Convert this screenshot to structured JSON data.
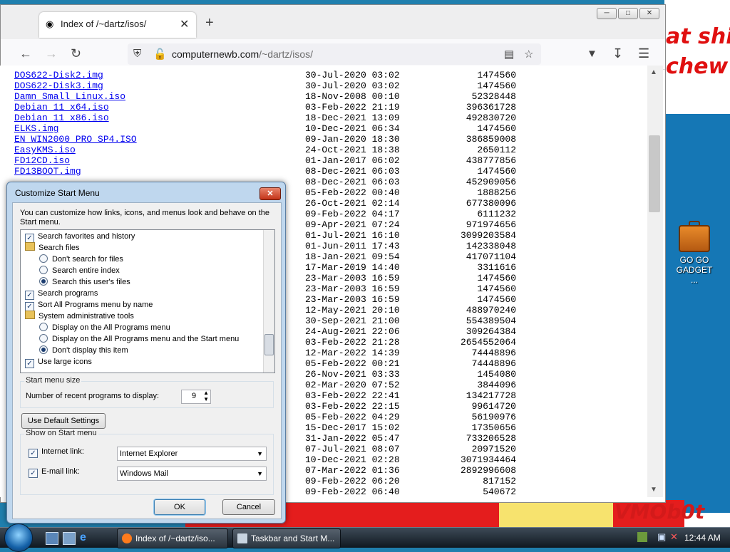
{
  "desktop": {
    "wallpaper_text_1": "at shit",
    "wallpaper_text_2": "chew",
    "brand": "VMOb0t",
    "icon_label_1": "GO GO",
    "icon_label_2": "GADGET ..."
  },
  "browser": {
    "tab_title": "Index of /~dartz/isos/",
    "url_host": "computernewb.com",
    "url_path": "/~dartz/isos/",
    "icons": {
      "back": "back-arrow-icon",
      "forward": "forward-arrow-icon",
      "reload": "reload-icon",
      "shield": "shield-icon",
      "reader": "reader-view-icon",
      "bookmark": "star-icon",
      "pocket": "pocket-icon",
      "downloads": "download-icon",
      "menu": "hamburger-menu-icon"
    }
  },
  "listing": {
    "rows": [
      {
        "name": "DOS622-Disk2.img",
        "date": "30-Jul-2020 03:02",
        "size": "1474560"
      },
      {
        "name": "DOS622-Disk3.img",
        "date": "30-Jul-2020 03:02",
        "size": "1474560"
      },
      {
        "name": "Damn Small Linux.iso",
        "date": "18-Nov-2008 00:10",
        "size": "52328448"
      },
      {
        "name": "Debian 11 x64.iso",
        "date": "03-Feb-2022 21:19",
        "size": "396361728"
      },
      {
        "name": "Debian 11 x86.iso",
        "date": "18-Dec-2021 13:09",
        "size": "492830720"
      },
      {
        "name": "ELKS.img",
        "date": "10-Dec-2021 06:34",
        "size": "1474560"
      },
      {
        "name": "EN WIN2000 PRO SP4.ISO",
        "date": "09-Jan-2020 18:30",
        "size": "386859008"
      },
      {
        "name": "EasyKMS.iso",
        "date": "24-Oct-2021 18:38",
        "size": "2650112"
      },
      {
        "name": "FD12CD.iso",
        "date": "01-Jan-2017 06:02",
        "size": "438777856"
      },
      {
        "name": "FD13BOOT.img",
        "date": "08-Dec-2021 06:03",
        "size": "1474560"
      },
      {
        "name": "",
        "date": "08-Dec-2021 06:03",
        "size": "452909056"
      },
      {
        "name": "",
        "date": "05-Feb-2022 00:40",
        "size": "1888256"
      },
      {
        "name": "",
        "date": "26-Oct-2021 02:14",
        "size": "677380096"
      },
      {
        "name": "",
        "date": "09-Feb-2022 04:17",
        "size": "6111232"
      },
      {
        "name": "",
        "date": "09-Apr-2021 07:24",
        "size": "971974656"
      },
      {
        "name": "",
        "date": "01-Jul-2021 16:10",
        "size": "3099203584"
      },
      {
        "name": "",
        "date": "01-Jun-2011 17:43",
        "size": "142338048"
      },
      {
        "name": "",
        "date": "18-Jan-2021 09:54",
        "size": "417071104"
      },
      {
        "name": "",
        "date": "17-Mar-2019 14:40",
        "size": "3311616"
      },
      {
        "name": "",
        "date": "23-Mar-2003 16:59",
        "size": "1474560"
      },
      {
        "name": "",
        "date": "23-Mar-2003 16:59",
        "size": "1474560"
      },
      {
        "name": "",
        "date": "23-Mar-2003 16:59",
        "size": "1474560"
      },
      {
        "name": "",
        "date": "12-May-2021 20:10",
        "size": "488970240"
      },
      {
        "name": "",
        "date": "30-Sep-2021 21:00",
        "size": "554389504"
      },
      {
        "name": "",
        "date": "24-Aug-2021 22:06",
        "size": "309264384"
      },
      {
        "name": "",
        "date": "03-Feb-2022 21:28",
        "size": "2654552064"
      },
      {
        "name": "",
        "date": "12-Mar-2022 14:39",
        "size": "74448896"
      },
      {
        "name": "",
        "date": "05-Feb-2022 00:21",
        "size": "74448896"
      },
      {
        "name": "",
        "date": "26-Nov-2021 03:33",
        "size": "1454080"
      },
      {
        "name": "",
        "date": "02-Mar-2020 07:52",
        "size": "3844096"
      },
      {
        "name": "",
        "date": "03-Feb-2022 22:41",
        "size": "134217728"
      },
      {
        "name": "",
        "date": "03-Feb-2022 22:15",
        "size": "99614720"
      },
      {
        "name": "",
        "date": "05-Feb-2022 04:29",
        "size": "56190976"
      },
      {
        "name": "",
        "date": "15-Dec-2017 15:02",
        "size": "17350656"
      },
      {
        "name": "",
        "date": "31-Jan-2022 05:47",
        "size": "733206528"
      },
      {
        "name": "",
        "date": "07-Jul-2021 08:07",
        "size": "20971520"
      },
      {
        "name": "",
        "date": "10-Dec-2021 02:28",
        "size": "3071934464"
      },
      {
        "name": "",
        "date": "07-Mar-2022 01:36",
        "size": "2892996608"
      },
      {
        "name": "",
        "date": "09-Feb-2022 06:20",
        "size": "817152"
      },
      {
        "name": "",
        "date": "09-Feb-2022 06:40",
        "size": "540672"
      }
    ]
  },
  "dialog": {
    "title": "Customize Start Menu",
    "description": "You can customize how links, icons, and menus look and behave on the Start menu.",
    "options": [
      {
        "type": "checkbox",
        "checked": true,
        "label": "Search favorites and history",
        "indent": 0
      },
      {
        "type": "folder",
        "label": "Search files",
        "indent": 0
      },
      {
        "type": "radio",
        "checked": false,
        "label": "Don't search for files",
        "indent": 1
      },
      {
        "type": "radio",
        "checked": false,
        "label": "Search entire index",
        "indent": 1
      },
      {
        "type": "radio",
        "checked": true,
        "label": "Search this user's files",
        "indent": 1
      },
      {
        "type": "checkbox",
        "checked": true,
        "label": "Search programs",
        "indent": 0
      },
      {
        "type": "checkbox",
        "checked": true,
        "label": "Sort All Programs menu by name",
        "indent": 0
      },
      {
        "type": "folder",
        "label": "System administrative tools",
        "indent": 0
      },
      {
        "type": "radio",
        "checked": false,
        "label": "Display on the All Programs menu",
        "indent": 1
      },
      {
        "type": "radio",
        "checked": false,
        "label": "Display on the All Programs menu and the Start menu",
        "indent": 1
      },
      {
        "type": "radio",
        "checked": true,
        "label": "Don't display this item",
        "indent": 1
      },
      {
        "type": "checkbox",
        "checked": true,
        "label": "Use large icons",
        "indent": 0
      }
    ],
    "menu_size_group": "Start menu size",
    "recent_label": "Number of recent programs to display:",
    "recent_value": "9",
    "default_button": "Use Default Settings",
    "show_group": "Show on Start menu",
    "internet_label": "Internet link:",
    "internet_value": "Internet Explorer",
    "email_label": "E-mail link:",
    "email_value": "Windows Mail",
    "ok": "OK",
    "cancel": "Cancel"
  },
  "taskbar": {
    "task1": "Index of /~dartz/iso...",
    "task2": "Taskbar and Start M...",
    "clock": "12:44 AM"
  }
}
